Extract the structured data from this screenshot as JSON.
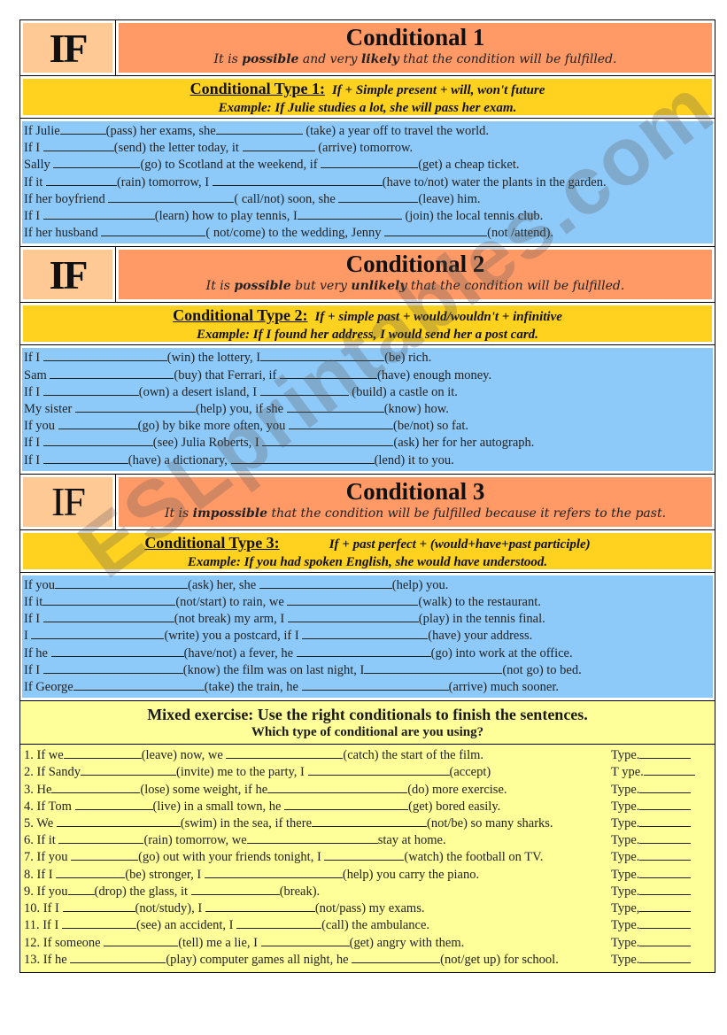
{
  "sections": [
    {
      "if_label": "IF",
      "title": "Conditional 1",
      "subtitle_parts": [
        "It is ",
        "possible",
        " and very ",
        "likely",
        " that the condition will be fulfilled."
      ],
      "rule_label": "Conditional Type 1:",
      "rule_formula": "If + Simple present + will, won't future",
      "rule_example": "Example: If Julie studies a lot, she will pass her exam.",
      "lines": [
        [
          "If Julie",
          52,
          "(pass) her exams, she",
          98,
          " (take) a year off to travel the world."
        ],
        [
          "If I ",
          80,
          "(send) the letter today, it ",
          82,
          " (arrive) tomorrow."
        ],
        [
          "Sally ",
          98,
          "(go) to Scotland at the weekend, if ",
          110,
          "(get) a cheap ticket."
        ],
        [
          "If it ",
          80,
          "(rain) tomorrow, I ",
          192,
          "(have to/not) water the plants in the garden."
        ],
        [
          "If her boyfriend ",
          142,
          "( call/not) soon, she ",
          90,
          "(leave) him."
        ],
        [
          "If I ",
          126,
          "(learn) how to play tennis, I",
          118,
          " (join) the local tennis club."
        ],
        [
          "If her husband ",
          118,
          "( not/come) to the wedding, Jenny ",
          116,
          "(not /attend)."
        ]
      ]
    },
    {
      "if_label": "IF",
      "title": "Conditional 2",
      "subtitle_parts": [
        "It is ",
        "possible",
        " but very ",
        "unlikely",
        " that the condition will be fulfilled."
      ],
      "rule_label": "Conditional Type 2:",
      "rule_formula": "If + simple past + would/wouldn't + infinitive",
      "rule_example": "Example: If I found her address, I would send her a post card.",
      "lines": [
        [
          "If I ",
          140,
          "(win) the lottery, I",
          140,
          "(be) rich."
        ],
        [
          "Sam ",
          140,
          "(buy) that Ferrari, if ",
          110,
          "(have) enough money."
        ],
        [
          "If I ",
          108,
          "(own) a desert island, I ",
          100,
          " (build) a castle on it."
        ],
        [
          "My sister ",
          136,
          "(help) you, if she ",
          110,
          "(know) how."
        ],
        [
          "If you ",
          90,
          "(go) by bike more often, you ",
          118,
          "(be/not) so fat."
        ],
        [
          "If I ",
          124,
          "(see) Julia Roberts, I ",
          148,
          "(ask) her for her autograph."
        ],
        [
          "If I ",
          96,
          "(have) a dictionary, ",
          162,
          "(lend) it to you."
        ]
      ]
    },
    {
      "if_label": "IF",
      "title": "Conditional 3",
      "subtitle_parts": [
        "It is ",
        "impossible",
        " that the condition will be fulfilled because it refers to the past."
      ],
      "rule_label": "Conditional Type 3:",
      "rule_formula": "If + past perfect + (would+have+past participle)",
      "rule_example": "Example: If you had spoken English, she would have understood.",
      "lines": [
        [
          "If you",
          150,
          "(ask) her, she ",
          150,
          "(help) you."
        ],
        [
          "If it",
          150,
          "(not/start) to rain, we ",
          148,
          "(walk) to the restaurant."
        ],
        [
          "If I ",
          148,
          "(not break) my arm, I ",
          148,
          "(play) in the tennis final."
        ],
        [
          "I ",
          150,
          "(write) you a postcard, if I ",
          142,
          "(have) your address."
        ],
        [
          "If he ",
          150,
          "(have/not) a fever, he ",
          152,
          "(go) into work at the office."
        ],
        [
          "If I ",
          158,
          "(know) the film was on last night, I",
          156,
          "(not go) to bed."
        ],
        [
          "If George",
          148,
          "(take) the train, he ",
          166,
          "(arrive) much sooner."
        ]
      ]
    }
  ],
  "mixed": {
    "title": "Mixed exercise: Use the right conditionals to finish the sentences.",
    "subtitle": "Which type of conditional are you using?",
    "lines": [
      {
        "parts": [
          "1. If we",
          88,
          "(leave) now, we ",
          132,
          "(catch) the start of the film."
        ],
        "type": "Type.",
        "tw": 58
      },
      {
        "parts": [
          "2. If Sandy",
          108,
          "(invite) me to the party, I ",
          160,
          "(accept)"
        ],
        "type": "T ype.",
        "tw": 58
      },
      {
        "parts": [
          "3. He",
          100,
          "(lose) some weight, if he",
          158,
          "(do) more exercise."
        ],
        "type": "Type.",
        "tw": 58
      },
      {
        "parts": [
          "4. If Tom ",
          88,
          "(live) in a small town, he ",
          140,
          "(get) bored easily."
        ],
        "type": "Type.",
        "tw": 58
      },
      {
        "parts": [
          "5. We ",
          140,
          "(swim) in the sea, if there",
          130,
          "(not/be) so many sharks."
        ],
        "type": "Type.",
        "tw": 58
      },
      {
        "parts": [
          "6. If it ",
          96,
          "(rain) tomorrow, we",
          148,
          "stay at home."
        ],
        "type": "Type.",
        "tw": 58
      },
      {
        "parts": [
          "7. If you ",
          76,
          "(go) out with your friends tonight, I ",
          90,
          "(watch) the football on TV."
        ],
        "type": "Type.",
        "tw": 58
      },
      {
        "parts": [
          "8. If I ",
          78,
          "(be) stronger, I ",
          156,
          "(help) you carry the piano."
        ],
        "type": "Type.",
        "tw": 58
      },
      {
        "parts": [
          "9. If you",
          30,
          "(drop) the glass, it ",
          100,
          "(break)."
        ],
        "type": "Type.",
        "tw": 58
      },
      {
        "parts": [
          "10. If I ",
          82,
          "(not/study), I ",
          124,
          "(not/pass) my exams."
        ],
        "type": "Type,",
        "tw": 58
      },
      {
        "parts": [
          "11. If I ",
          84,
          "(see) an accident, I ",
          96,
          "(call) the ambulance."
        ],
        "type": "Type.",
        "tw": 58
      },
      {
        "parts": [
          "12. If someone ",
          84,
          "(tell) me a lie, I ",
          100,
          "(get) angry with them."
        ],
        "type": "Type.",
        "tw": 58
      },
      {
        "parts": [
          "13. If he ",
          108,
          "(play) computer games all night, he ",
          100,
          "(not/get up) for school."
        ],
        "type": "Type.",
        "tw": 58
      }
    ]
  },
  "watermark": "ESLprintables.com",
  "colors": {
    "if_cell": "#ffc996",
    "title_cell": "#ff9966",
    "rule_band": "#ffd21f",
    "exercise_band": "#8ecaf9",
    "mixed_band": "#ffff99"
  }
}
